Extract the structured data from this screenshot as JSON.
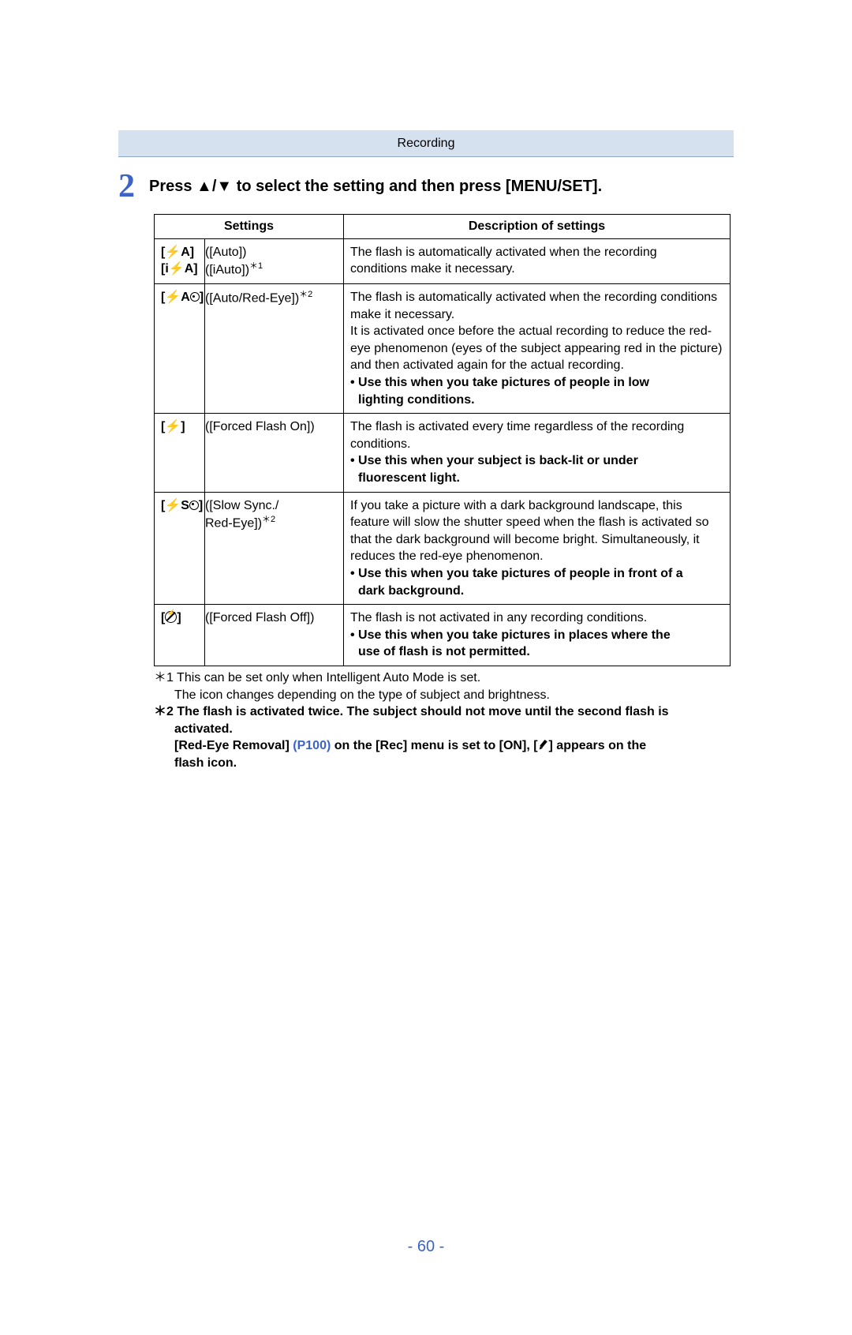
{
  "breadcrumb": "Recording",
  "step": {
    "number": "2",
    "text": "Press ▲/▼ to select the setting and then press [MENU/SET]."
  },
  "table": {
    "headers": {
      "settings": "Settings",
      "description": "Description of settings"
    },
    "rows": {
      "auto": {
        "icon1": "[⚡A]",
        "label1": "([Auto])",
        "icon2": "[i⚡A]",
        "label2_prefix": "([iAuto])",
        "label2_sup": "＊1",
        "desc_line1": "The flash is automatically activated when the recording",
        "desc_line2": "conditions make it necessary."
      },
      "auto_redeye": {
        "icon_main": "[⚡A",
        "icon_close": "]",
        "label_prefix": "([Auto/Red-Eye])",
        "label_sup": "＊2",
        "desc1": "The flash is automatically activated when the recording conditions make it necessary.",
        "desc2": "It is activated once before the actual recording to reduce the red-eye phenomenon (eyes of the subject appearing red in the picture) and then activated again for the actual recording.",
        "use1": "Use this when you take pictures of people in low",
        "use1b": "lighting conditions."
      },
      "forced_on": {
        "icon": "[⚡]",
        "label": "([Forced Flash On])",
        "desc": "The flash is activated every time regardless of the recording conditions.",
        "use1": "Use this when your subject is back-lit or under",
        "use1b": "fluorescent light."
      },
      "slow_sync": {
        "icon_main": "[⚡S",
        "icon_close": "]",
        "label_prefix": "([Slow Sync./",
        "label_line2": "Red-Eye])",
        "label_sup": "＊2",
        "desc": "If you take a picture with a dark background landscape, this feature will slow the shutter speed when the flash is activated so that the dark background will become bright. Simultaneously, it reduces the red-eye phenomenon.",
        "use1": "Use this when you take pictures of people in front of a",
        "use1b": "dark background."
      },
      "forced_off": {
        "icon_open": "[",
        "icon_close": "]",
        "label": "([Forced Flash Off])",
        "desc": "The flash is not activated in any recording conditions.",
        "use1": "Use this when you take pictures in places where the",
        "use1b": "use of flash is not permitted."
      }
    }
  },
  "footnotes": {
    "fn1_a": "＊1 This can be set only when Intelligent Auto Mode is set.",
    "fn1_b": "The icon changes depending on the type of subject and brightness.",
    "fn2_a": "＊2 The flash is activated twice. The subject should not move until the second flash is",
    "fn2_a2": "activated.",
    "fn2_b_pre": "[Red-Eye Removal] ",
    "fn2_b_link": "(P100)",
    "fn2_b_mid": " on the [Rec] menu is set to [ON], [",
    "fn2_b_post": "] appears on the",
    "fn2_b2": "flash icon."
  },
  "page_number": "- 60 -"
}
